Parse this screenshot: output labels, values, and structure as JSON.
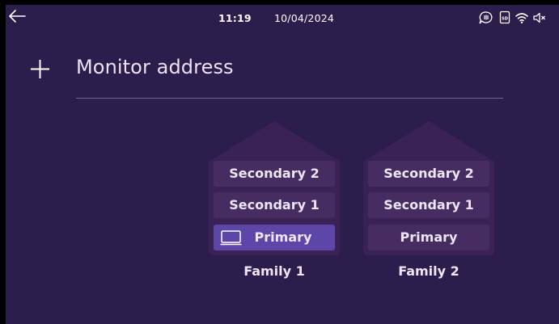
{
  "status": {
    "time": "11:19",
    "date": "10/04/2024",
    "icons": [
      "intercom-icon",
      "sd-card-icon",
      "wifi-icon",
      "speaker-muted-icon"
    ]
  },
  "header": {
    "title": "Monitor address"
  },
  "families": [
    {
      "name": "Family 1",
      "floors": [
        "Secondary 2",
        "Secondary 1",
        "Primary"
      ],
      "selected": "Primary"
    },
    {
      "name": "Family 2",
      "floors": [
        "Secondary 2",
        "Secondary 1",
        "Primary"
      ],
      "selected": null
    }
  ],
  "colors": {
    "background": "#2b1d4c",
    "house": "#3a2257",
    "floor": "#472c62",
    "selected_floor": "#5c46a8",
    "text": "#ece6f6"
  }
}
